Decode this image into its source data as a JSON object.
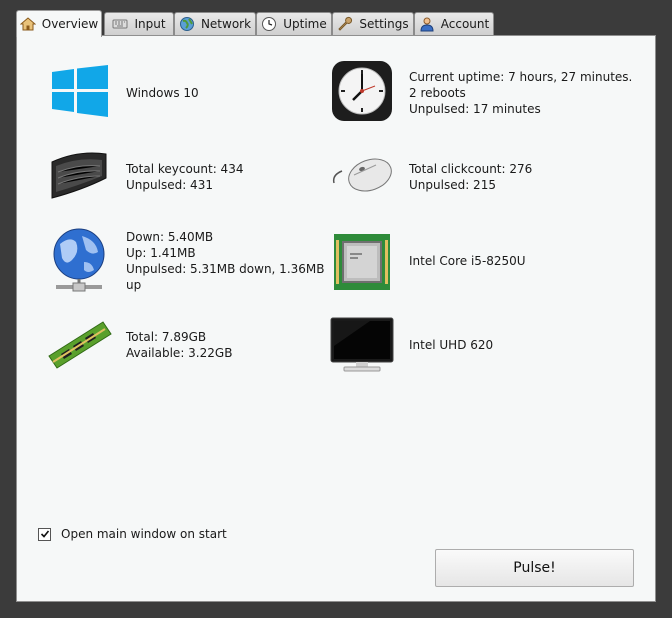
{
  "tabs": [
    {
      "label": "Overview",
      "icon": "home-icon"
    },
    {
      "label": "Input",
      "icon": "keyboard-icon"
    },
    {
      "label": "Network",
      "icon": "globe-icon"
    },
    {
      "label": "Uptime",
      "icon": "clock-icon"
    },
    {
      "label": "Settings",
      "icon": "wrench-icon"
    },
    {
      "label": "Account",
      "icon": "user-icon"
    }
  ],
  "overview": {
    "os": {
      "line1": "Windows 10"
    },
    "uptime": {
      "line1": "Current uptime: 7 hours, 27 minutes.",
      "line2": "2 reboots",
      "line3": "Unpulsed: 17 minutes"
    },
    "keyboard": {
      "line1": "Total keycount: 434",
      "line2": "Unpulsed: 431"
    },
    "mouse": {
      "line1": "Total clickcount: 276",
      "line2": "Unpulsed: 215"
    },
    "network": {
      "line1": "Down: 5.40MB",
      "line2": "Up: 1.41MB",
      "line3": "Unpulsed: 5.31MB down, 1.36MB",
      "line4": "up"
    },
    "cpu": {
      "line1": "Intel Core i5-8250U"
    },
    "memory": {
      "line1": "Total: 7.89GB",
      "line2": "Available: 3.22GB"
    },
    "gpu": {
      "line1": "Intel UHD 620"
    }
  },
  "options": {
    "open_on_start_label": "Open main window on start",
    "open_on_start_checked": true
  },
  "pulse_button": {
    "label": "Pulse!"
  },
  "colors": {
    "windows_blue": "#11a7e8",
    "cpu_green": "#2e8b3a",
    "ram_green": "#5aa02c"
  }
}
